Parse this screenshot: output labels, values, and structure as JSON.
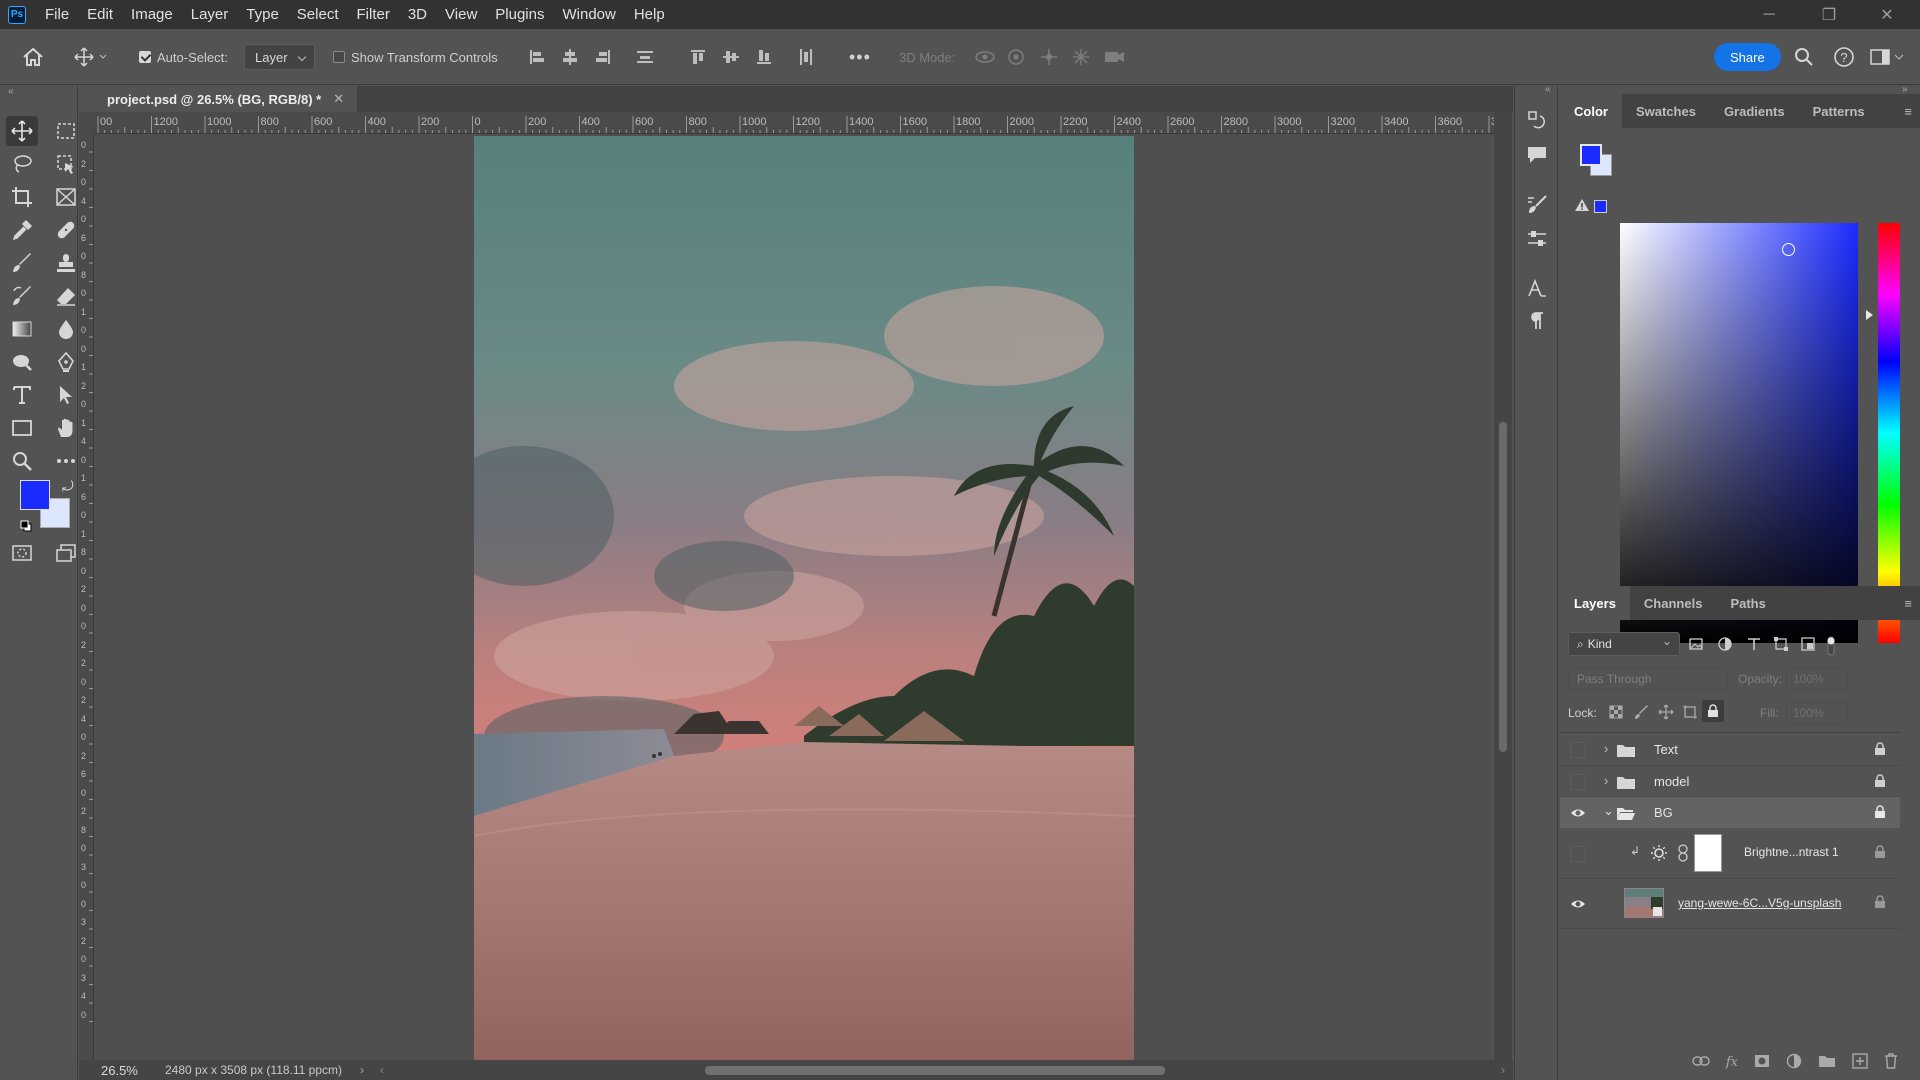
{
  "app": {
    "logo_text": "Ps",
    "menus": [
      "File",
      "Edit",
      "Image",
      "Layer",
      "Type",
      "Select",
      "Filter",
      "3D",
      "View",
      "Plugins",
      "Window",
      "Help"
    ]
  },
  "options_bar": {
    "auto_select_label": "Auto-Select:",
    "auto_select_checked": true,
    "auto_select_target": "Layer",
    "show_transform_label": "Show Transform Controls",
    "show_transform_checked": false,
    "mode_3d_label": "3D Mode:",
    "share_label": "Share"
  },
  "document": {
    "tab_title": "project.psd @ 26.5% (BG, RGB/8) *",
    "zoom": "26.5%",
    "doc_info": "2480 px x 3508 px (118.11 ppcm)"
  },
  "ruler": {
    "h_ticks": [
      "00",
      "1200",
      "1000",
      "800",
      "600",
      "400",
      "200",
      "0",
      "200",
      "400",
      "600",
      "800",
      "1000",
      "1200",
      "1400",
      "1600",
      "1800",
      "2000",
      "2200",
      "2400",
      "2600",
      "2800",
      "3000",
      "3200",
      "3400",
      "3600",
      "3"
    ],
    "v_ticks": [
      "0",
      "2",
      "0",
      "4",
      "0",
      "6",
      "0",
      "8",
      "0",
      "1",
      "0",
      "0",
      "1",
      "2",
      "0",
      "1",
      "4",
      "0",
      "1",
      "6",
      "0",
      "1",
      "8",
      "0",
      "2",
      "0",
      "0",
      "2",
      "2",
      "0",
      "2",
      "4",
      "0",
      "2",
      "6",
      "0",
      "2",
      "8",
      "0",
      "3",
      "0",
      "0",
      "3",
      "2",
      "0",
      "3",
      "4",
      "0"
    ]
  },
  "colors": {
    "foreground": "#1a2bff",
    "background": "#dde6ff",
    "accent": "#1473e6"
  },
  "color_panel": {
    "tabs": [
      "Color",
      "Swatches",
      "Gradients",
      "Patterns"
    ],
    "active_tab": "Color"
  },
  "layers_panel": {
    "tabs": [
      "Layers",
      "Channels",
      "Paths"
    ],
    "active_tab": "Layers",
    "filter_kind": "Kind",
    "blend_mode": "Pass Through",
    "opacity_label": "Opacity:",
    "opacity_value": "100%",
    "lock_label": "Lock:",
    "fill_label": "Fill:",
    "fill_value": "100%",
    "layers": [
      {
        "name": "Text",
        "type": "group",
        "visible": false,
        "expanded": false,
        "locked": true
      },
      {
        "name": "model",
        "type": "group",
        "visible": false,
        "expanded": false,
        "locked": true
      },
      {
        "name": "BG",
        "type": "group",
        "visible": true,
        "expanded": true,
        "locked": true,
        "selected": true
      },
      {
        "name": "Brightne...ntrast 1",
        "type": "adjustment",
        "visible": false,
        "locked": true
      },
      {
        "name": "yang-wewe-6C...V5g-unsplash",
        "type": "smart-object",
        "visible": true,
        "locked": true
      }
    ]
  }
}
